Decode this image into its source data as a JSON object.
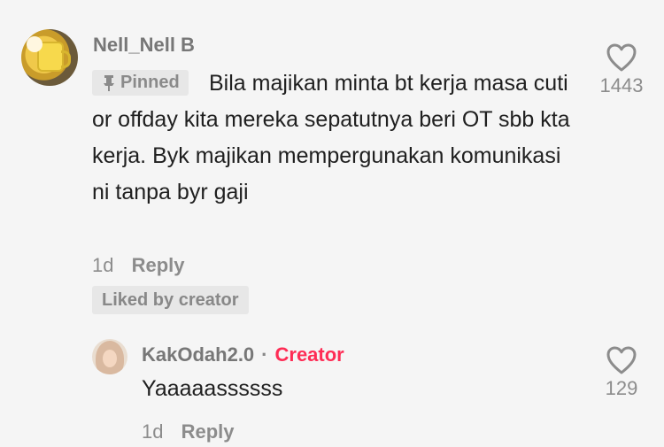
{
  "comment": {
    "username": "Nell_Nell B",
    "pinned_label": "Pinned",
    "text": "Bila majikan minta bt kerja masa cuti or offday kita mereka sepatutnya beri OT sbb kta kerja. Byk majikan mempergunakan komunikasi ni tanpa byr gaji",
    "time": "1d",
    "reply_label": "Reply",
    "liked_by_creator_label": "Liked by creator",
    "like_count": "1443",
    "like_icon": "heart-outline-icon"
  },
  "reply": {
    "username": "KakOdah2.0",
    "separator": "·",
    "creator_badge": "Creator",
    "text": "Yaaaaassssss",
    "time": "1d",
    "reply_label": "Reply",
    "like_count": "129",
    "like_icon": "heart-outline-icon"
  },
  "colors": {
    "background": "#f5f5f5",
    "creator_accent": "#fe2c55",
    "muted_text": "#8c8c8c",
    "body_text": "#202020"
  }
}
